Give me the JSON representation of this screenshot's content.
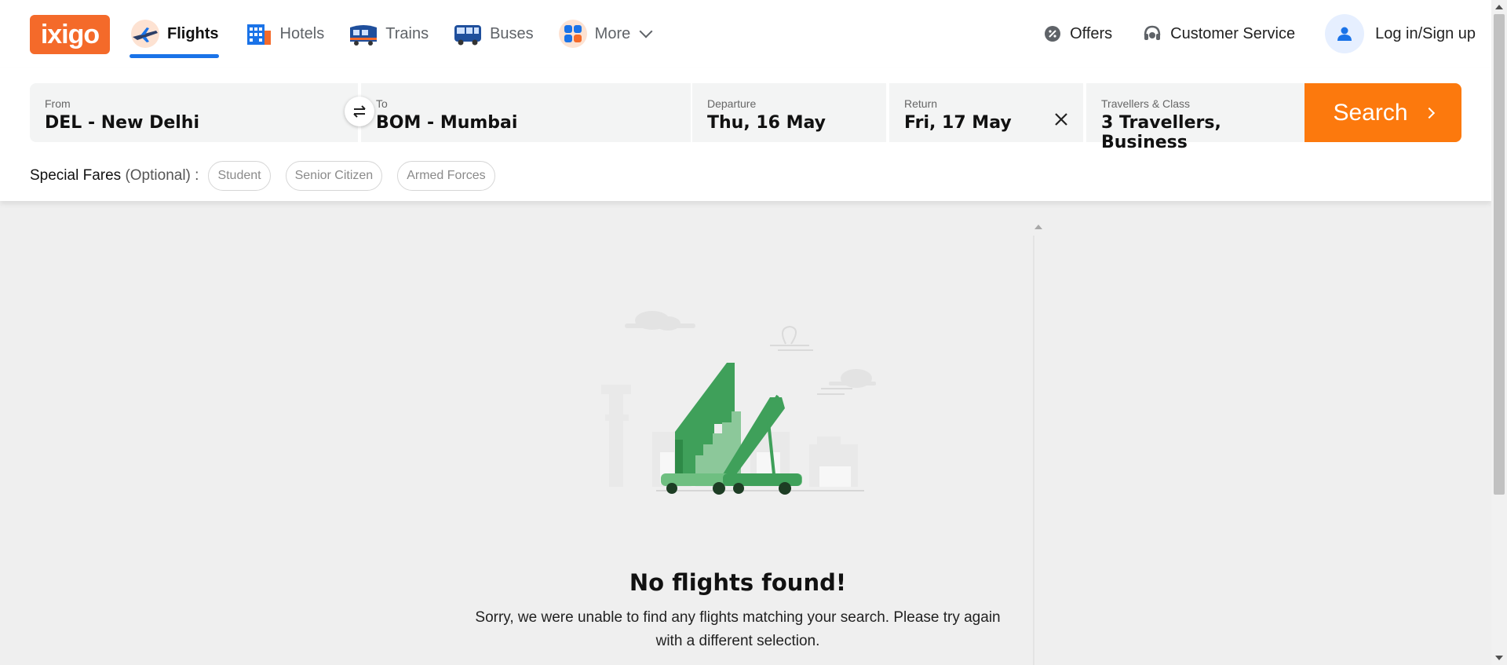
{
  "brand": {
    "logo_text": "ixigo",
    "color": "#f46a2a"
  },
  "nav": {
    "items": [
      {
        "label": "Flights",
        "icon": "airplane-icon",
        "active": true
      },
      {
        "label": "Hotels",
        "icon": "hotel-icon"
      },
      {
        "label": "Trains",
        "icon": "train-icon"
      },
      {
        "label": "Buses",
        "icon": "bus-icon"
      },
      {
        "label": "More",
        "icon": "grid-icon"
      }
    ]
  },
  "header_right": {
    "offers": "Offers",
    "customer_service": "Customer Service",
    "login": "Log in/Sign up"
  },
  "search": {
    "from": {
      "caption": "From",
      "value": "DEL - New Delhi"
    },
    "to": {
      "caption": "To",
      "value": "BOM - Mumbai"
    },
    "departure": {
      "caption": "Departure",
      "value": "Thu, 16 May"
    },
    "return": {
      "caption": "Return",
      "value": "Fri, 17 May"
    },
    "travellers": {
      "caption": "Travellers & Class",
      "value": "3 Travellers, Business"
    },
    "button_label": "Search",
    "button_color": "#fc790d"
  },
  "special_fares": {
    "label": "Special Fares",
    "optional": "(Optional) :",
    "chips": [
      "Student",
      "Senior Citizen",
      "Armed Forces"
    ]
  },
  "empty_state": {
    "title": "No flights found!",
    "message": "Sorry, we were unable to find any flights matching your search. Please try again with a different selection.",
    "illustration": "airport-stairs-illustration"
  },
  "colors": {
    "accent": "#1a73e8",
    "stairs_green": "#3fa05a"
  }
}
